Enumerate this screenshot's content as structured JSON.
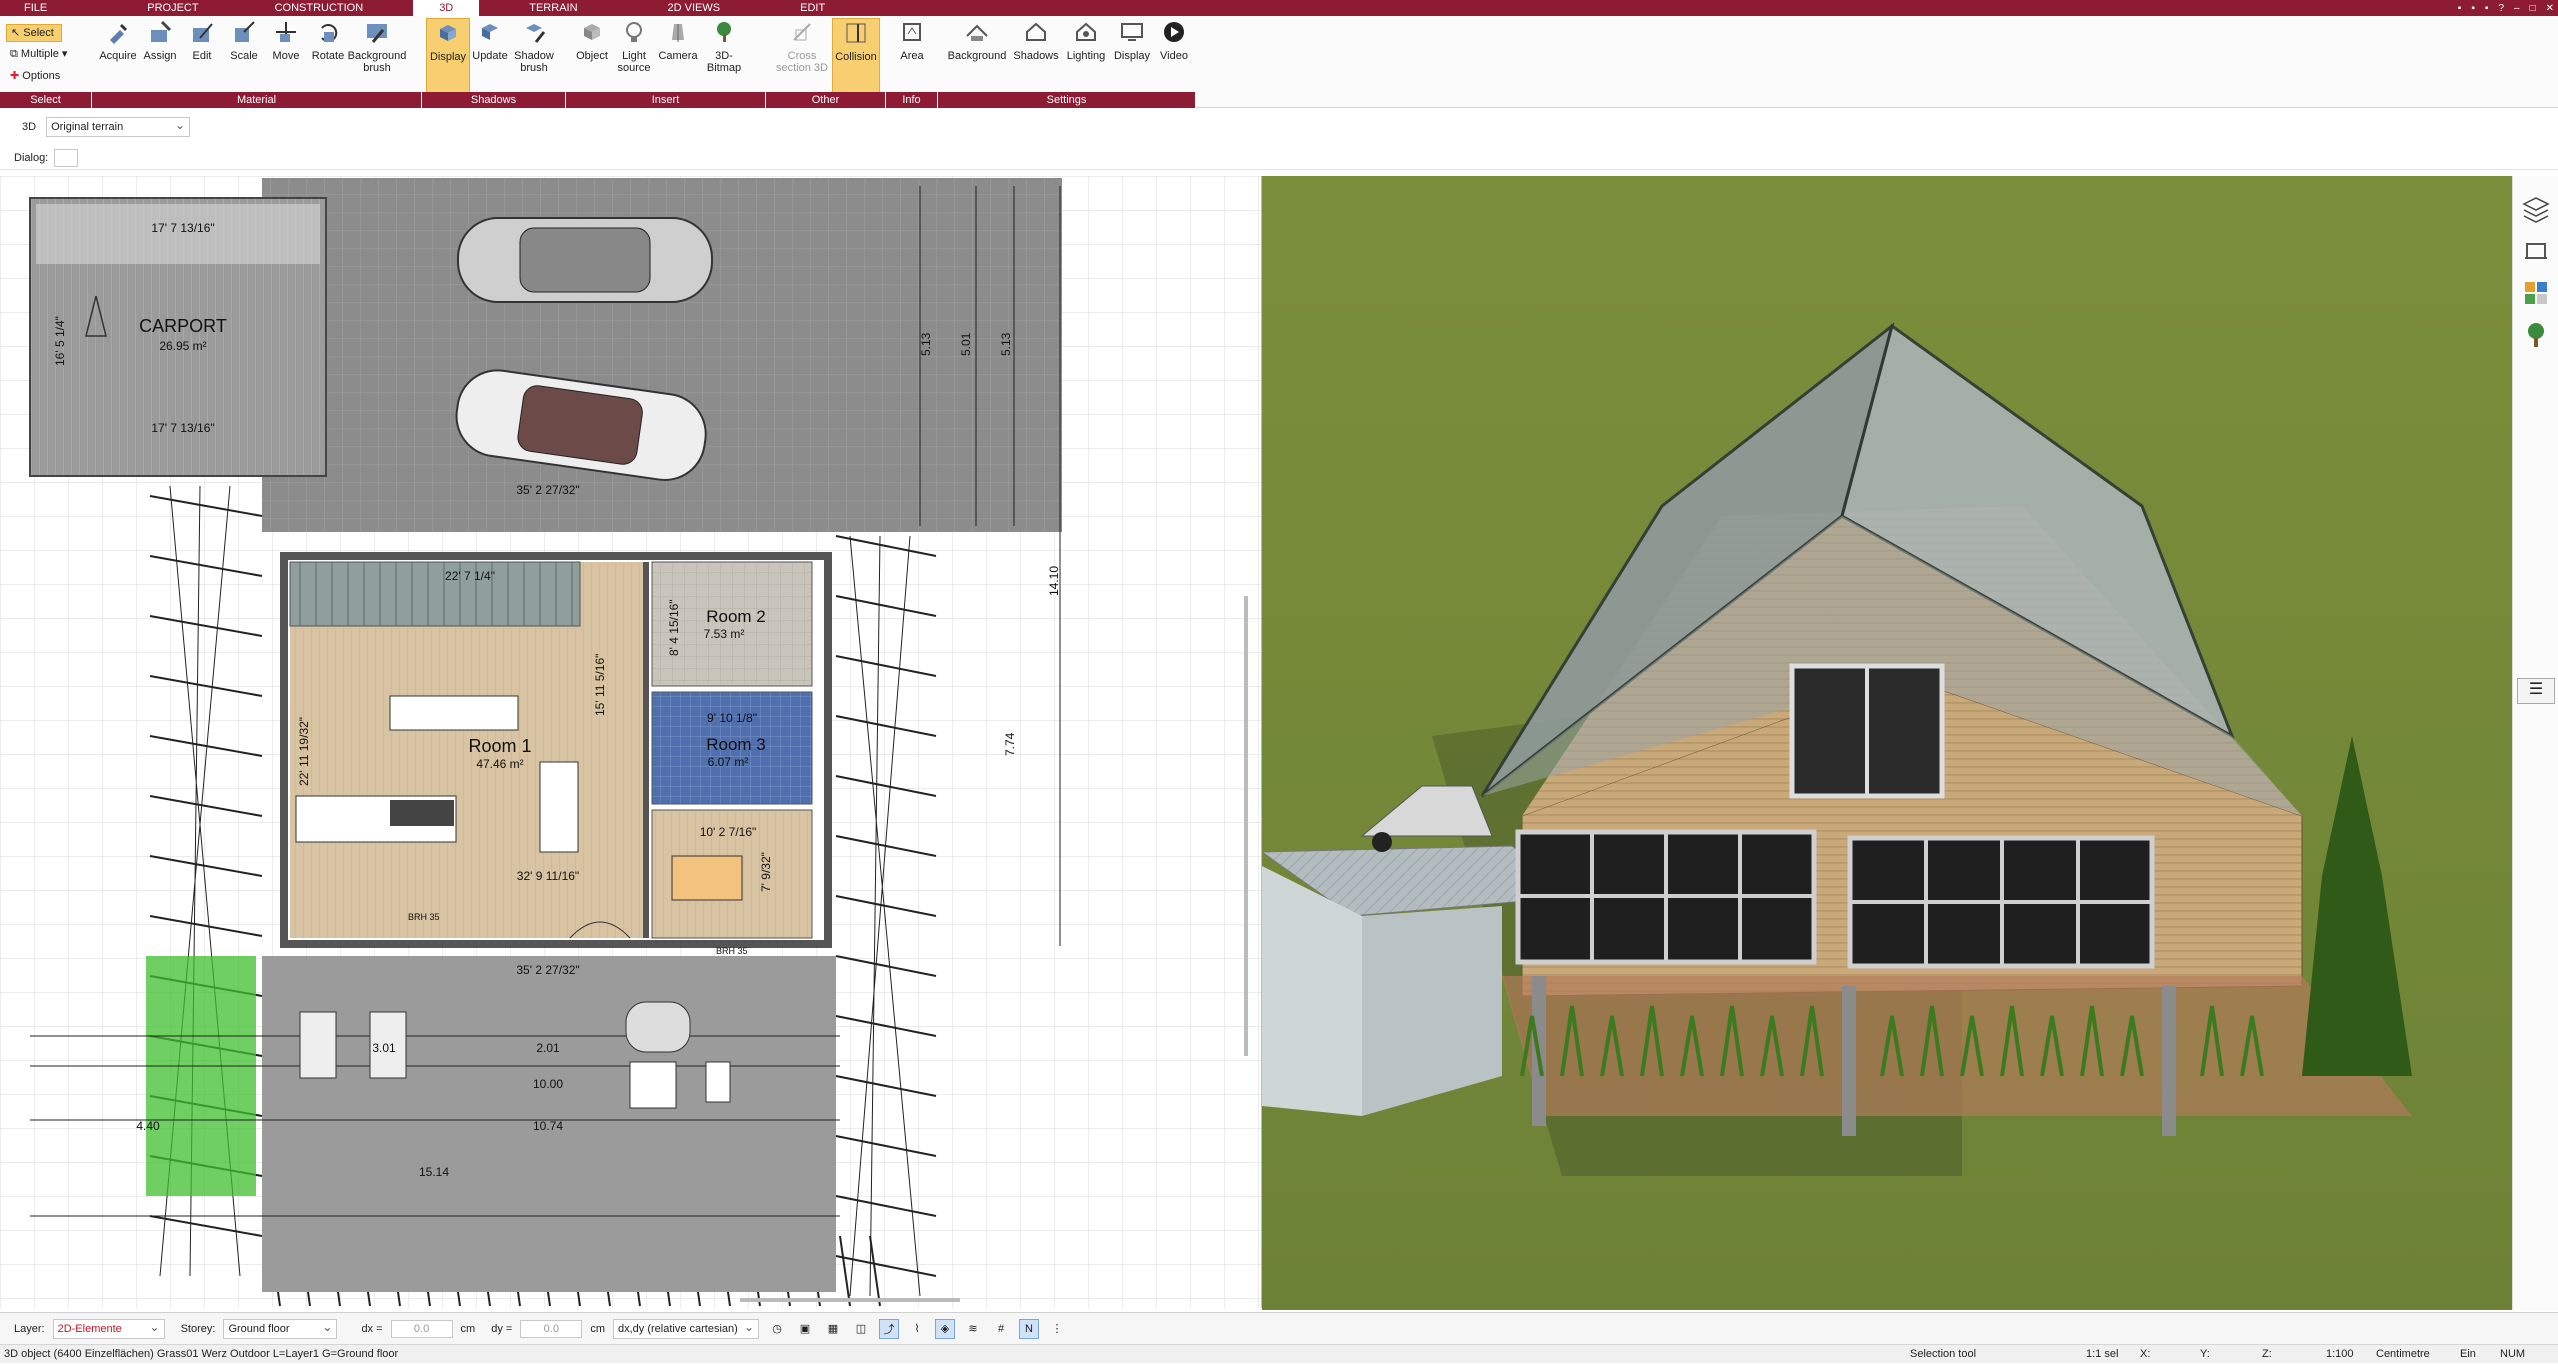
{
  "menu": {
    "tabs": [
      "FILE",
      "PROJECT",
      "CONSTRUCTION",
      "3D",
      "TERRAIN",
      "2D VIEWS",
      "EDIT"
    ],
    "active": "3D"
  },
  "ribbon": {
    "select": {
      "select_label": "Select",
      "multiple_label": "Multiple",
      "options_label": "Options",
      "group": "Select"
    },
    "material": {
      "buttons": [
        "Acquire",
        "Assign",
        "Edit",
        "Scale",
        "Move",
        "Rotate",
        "Background brush"
      ],
      "group": "Material"
    },
    "shadows": {
      "buttons": [
        "Display",
        "Update",
        "Shadow brush"
      ],
      "group": "Shadows"
    },
    "insert": {
      "buttons": [
        "Object",
        "Light source",
        "Camera",
        "3D-Bitmap"
      ],
      "group": "Insert"
    },
    "other": {
      "buttons": [
        "Cross section 3D",
        "Collision"
      ],
      "group": "Other"
    },
    "info": {
      "buttons": [
        "Area"
      ],
      "group": "Info"
    },
    "settings": {
      "buttons": [
        "Background",
        "Shadows",
        "Lighting",
        "Display",
        "Video"
      ],
      "group": "Settings"
    }
  },
  "toolbar": {
    "mode": "3D",
    "terrain": "Original terrain"
  },
  "dialog": {
    "label": "Dialog:"
  },
  "plan": {
    "carport": {
      "name": "CARPORT",
      "area": "26.95 m²",
      "dim_top": "17' 7 13/16\"",
      "dim_bottom": "17' 7 13/16\"",
      "dim_side": "16' 5 1/4\""
    },
    "room1": {
      "name": "Room 1",
      "area": "47.46 m²"
    },
    "room2": {
      "name": "Room 2",
      "area": "7.53 m²"
    },
    "room3": {
      "name": "Room 3",
      "area": "6.07 m²"
    },
    "dims": [
      "35' 2 27/32\"",
      "22' 7 1/4\"",
      "15' 11 5/16\"",
      "32' 9 11/16\"",
      "35' 2 27/32\"",
      "5.13",
      "5.01",
      "5.13",
      "14.10",
      "7.74",
      "10.74",
      "15.14",
      "3.01",
      "2.01",
      "10.00",
      "4.40",
      "22' 11 19/32\"",
      "8' 4 15/16\"",
      "9' 10 1/8\"",
      "10' 2 7/16\"",
      "7' 9/32\""
    ],
    "brh": "BRH 35"
  },
  "status": {
    "layer_label": "Layer:",
    "layer_value": "2D-Elemente",
    "storey_label": "Storey:",
    "storey_value": "Ground floor",
    "dx_label": "dx =",
    "dx_value": "0.0",
    "dy_label": "dy =",
    "dy_value": "0.0",
    "unit": "cm",
    "coord_mode": "dx,dy (relative cartesian)",
    "info": "3D object (6400 Einzelflächen) Grass01 Werz Outdoor L=Layer1 G=Ground floor",
    "tool": "Selection tool",
    "sel": "1:1 sel",
    "x": "X:",
    "y": "Y:",
    "z": "Z:",
    "scale": "1:100",
    "units": "Centimetre",
    "ein": "Ein",
    "num": "NUM"
  },
  "colors": {
    "brand": "#8d1b34",
    "active": "#f7cf71",
    "grass": "#7a8f3c"
  }
}
